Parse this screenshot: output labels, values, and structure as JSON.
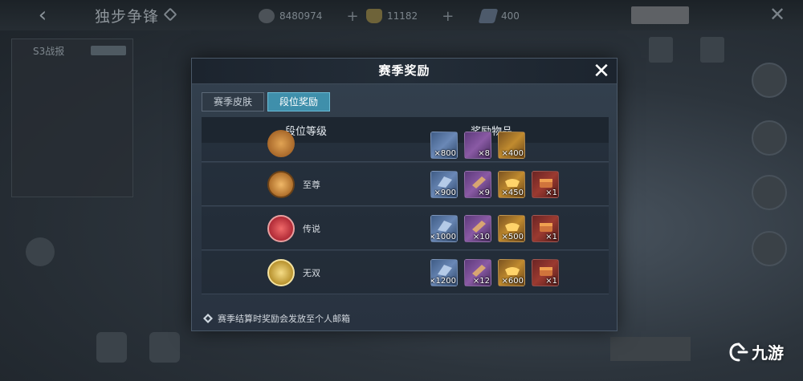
{
  "background": {
    "top_title": "独步争锋",
    "currencies": [
      {
        "icon": "silver-coin-icon",
        "value": "8480974"
      },
      {
        "icon": "gold-ingot-icon",
        "value": "11182"
      },
      {
        "icon": "gem-icon",
        "value": "400"
      }
    ],
    "left_panel": {
      "title": "S3战报"
    }
  },
  "modal": {
    "title": "赛季奖励",
    "tabs": [
      {
        "label": "赛季皮肤",
        "active": false
      },
      {
        "label": "段位奖励",
        "active": true
      }
    ],
    "columns": {
      "tier": "段位等级",
      "items": "奖励物品"
    },
    "partial_row": {
      "counts": [
        "×800",
        "×8",
        "×400"
      ]
    },
    "rows": [
      {
        "tier": "至尊",
        "badge_color": "#c88a3a",
        "items": [
          {
            "icon": "ticket-icon",
            "count": "×900"
          },
          {
            "icon": "scroll-icon",
            "count": "×9"
          },
          {
            "icon": "gold-ingot-icon",
            "count": "×450"
          },
          {
            "icon": "chest-icon",
            "count": "×1"
          }
        ]
      },
      {
        "tier": "传说",
        "badge_color": "#c9404a",
        "items": [
          {
            "icon": "ticket-icon",
            "count": "×1000"
          },
          {
            "icon": "scroll-icon",
            "count": "×10"
          },
          {
            "icon": "gold-ingot-icon",
            "count": "×500"
          },
          {
            "icon": "chest-icon",
            "count": "×1"
          }
        ]
      },
      {
        "tier": "无双",
        "badge_color": "#d4b04a",
        "items": [
          {
            "icon": "ticket-icon",
            "count": "×1200"
          },
          {
            "icon": "scroll-icon",
            "count": "×12"
          },
          {
            "icon": "gold-ingot-icon",
            "count": "×600"
          },
          {
            "icon": "chest-icon",
            "count": "×1"
          }
        ]
      }
    ],
    "footer_note": "赛季结算时奖励会发放至个人邮箱"
  },
  "watermark": {
    "text": "九游"
  }
}
